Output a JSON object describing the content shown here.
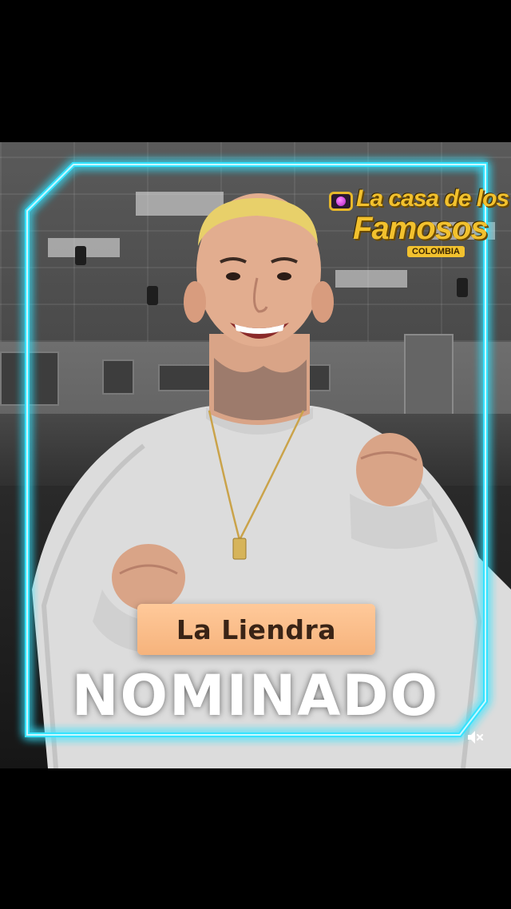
{
  "logo": {
    "line1": "La casa de los",
    "line2": "Famosos",
    "badge": "COLOMBIA",
    "icon": "camera-icon"
  },
  "contestant": {
    "name": "La Liendra",
    "status": "NOMINADO"
  },
  "controls": {
    "mute_icon": "speaker-muted-icon"
  },
  "colors": {
    "neon": "#36e3ff",
    "name_plate": "#f6b37c",
    "logo_gold": "#f2c12e",
    "status_text": "#ffffff"
  }
}
